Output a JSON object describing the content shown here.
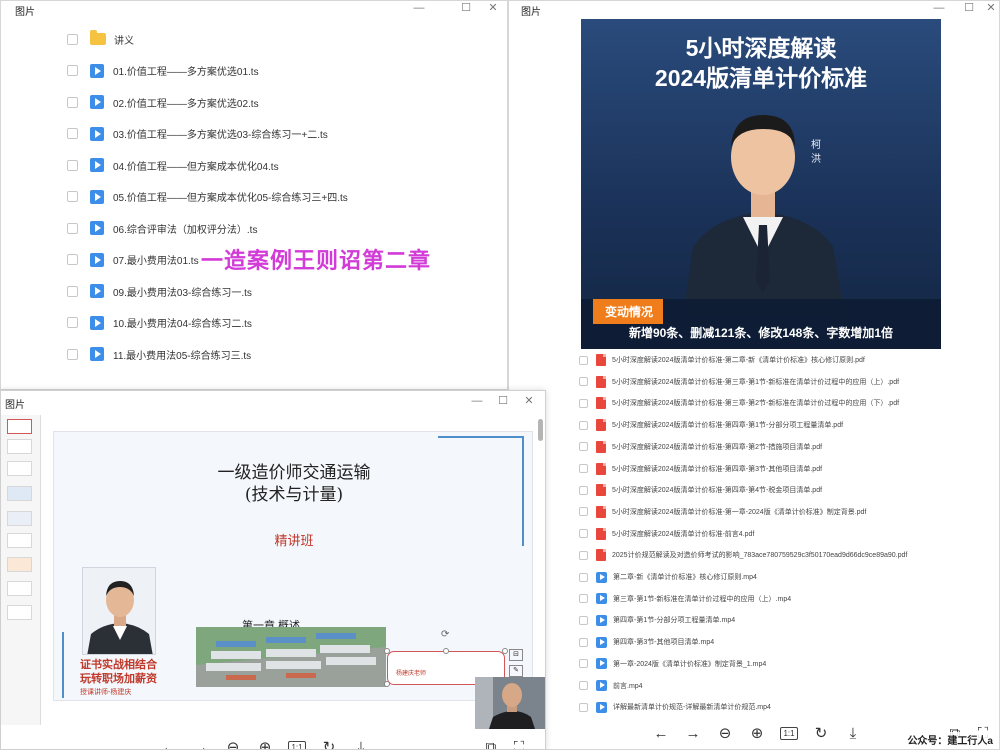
{
  "windows": {
    "left_top": {
      "title": "图片",
      "files": [
        {
          "name": "讲义",
          "type": "folder"
        },
        {
          "name": "01.价值工程——多方案优选01.ts",
          "type": "video"
        },
        {
          "name": "02.价值工程——多方案优选02.ts",
          "type": "video"
        },
        {
          "name": "03.价值工程——多方案优选03-综合练习一+二.ts",
          "type": "video"
        },
        {
          "name": "04.价值工程——但方案成本优化04.ts",
          "type": "video"
        },
        {
          "name": "05.价值工程——但方案成本优化05-综合练习三+四.ts",
          "type": "video"
        },
        {
          "name": "06.综合评审法（加权评分法）.ts",
          "type": "video"
        },
        {
          "name": "07.最小费用法01.ts",
          "type": "video"
        },
        {
          "name": "09.最小费用法03-综合练习一.ts",
          "type": "video"
        },
        {
          "name": "10.最小费用法04-综合练习二.ts",
          "type": "video"
        },
        {
          "name": "11.最小费用法05-综合练习三.ts",
          "type": "video"
        }
      ],
      "overlay_text": "一造案例王则诏第二章"
    },
    "right": {
      "title": "图片",
      "poster": {
        "title_line1": "5小时深度解读",
        "title_line2": "2024版清单计价标准",
        "lecturer": "柯洪",
        "tag": "变动情况",
        "subtitle": "新增90条、删减121条、修改148条、字数增加1倍",
        "bg_color": "#1f3a64",
        "tag_color": "#f07d1c"
      },
      "files": [
        {
          "name": "5小时深度解读2024版清单计价标准-第二章-新《清单计价标准》核心修订原则.pdf",
          "type": "pdf"
        },
        {
          "name": "5小时深度解读2024版清单计价标准-第三章-第1节-新标准在清单计价过程中的应用（上）.pdf",
          "type": "pdf"
        },
        {
          "name": "5小时深度解读2024版清单计价标准-第三章-第2节-新标准在清单计价过程中的应用（下）.pdf",
          "type": "pdf"
        },
        {
          "name": "5小时深度解读2024版清单计价标准-第四章-第1节-分部分项工程量清单.pdf",
          "type": "pdf"
        },
        {
          "name": "5小时深度解读2024版清单计价标准-第四章-第2节-措施项目清单.pdf",
          "type": "pdf"
        },
        {
          "name": "5小时深度解读2024版清单计价标准-第四章-第3节-其他项目清单.pdf",
          "type": "pdf"
        },
        {
          "name": "5小时深度解读2024版清单计价标准-第四章-第4节-税金项目清单.pdf",
          "type": "pdf"
        },
        {
          "name": "5小时深度解读2024版清单计价标准-第一章-2024版《清单计价标准》制定背景.pdf",
          "type": "pdf"
        },
        {
          "name": "5小时深度解读2024版清单计价标准-前言4.pdf",
          "type": "pdf"
        },
        {
          "name": "2025计价规范解读及对造价师考试的影响_783ace780759529c3f50170ead9d66dc9ce89a90.pdf",
          "type": "pdf"
        },
        {
          "name": "第二章-新《清单计价标准》核心修订原则.mp4",
          "type": "mp4"
        },
        {
          "name": "第三章-第1节-新标准在清单计价过程中的应用（上）.mp4",
          "type": "mp4"
        },
        {
          "name": "第四章-第1节-分部分项工程量清单.mp4",
          "type": "mp4"
        },
        {
          "name": "第四章-第3节-其他项目清单.mp4",
          "type": "mp4"
        },
        {
          "name": "第一章-2024版《清单计价标准》制定背景_1.mp4",
          "type": "mp4"
        },
        {
          "name": "前言.mp4",
          "type": "mp4"
        },
        {
          "name": "详解最新清单计价规范-详解最新清单计价规范.mp4",
          "type": "mp4"
        }
      ],
      "toolbar": [
        "prev-icon",
        "next-icon",
        "zoom-out-icon",
        "zoom-in-icon",
        "actual-size-icon",
        "rotate-icon",
        "download-icon"
      ],
      "actual_size_label": "1:1",
      "watermark": "公众号：建工行人a"
    },
    "presentation": {
      "title": "图片",
      "slide": {
        "title_line1": "一级造价师交通运输",
        "title_line2": "(技术与计量)",
        "class_name": "精讲班",
        "chapter": "第一章  概述",
        "slogan_line1": "证书实战相结合",
        "slogan_line2": "玩转职场加薪资",
        "slogan_small": "授课讲师-杨建庆",
        "box_label": "杨建庆老师"
      },
      "actual_size_label": "1:1"
    }
  }
}
